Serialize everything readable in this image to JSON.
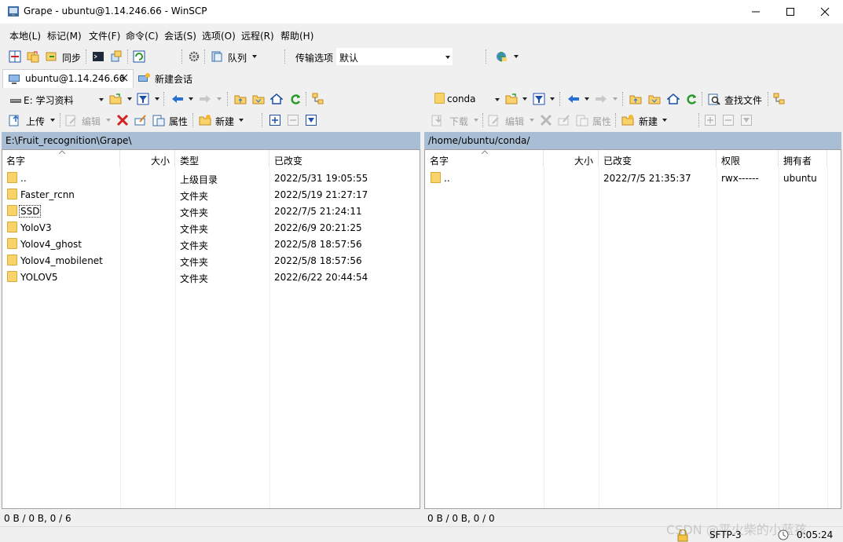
{
  "window": {
    "title": "Grape - ubuntu@1.14.246.66 - WinSCP",
    "icon": "winscp-app-icon"
  },
  "menu": [
    "本地(L)",
    "标记(M)",
    "文件(F)",
    "命令(C)",
    "会话(S)",
    "选项(O)",
    "远程(R)",
    "帮助(H)"
  ],
  "toolbar": {
    "sync_label": "同步",
    "queue_label": "队列",
    "transfer_options_label": "传输选项",
    "transfer_preset": "默认"
  },
  "tabs": [
    {
      "label": "ubuntu@1.14.246.66",
      "active": true
    },
    {
      "label": "新建会话",
      "active": false
    }
  ],
  "local": {
    "drive": "E: 学习资料",
    "upload_label": "上传",
    "edit_label": "编辑",
    "properties_label": "属性",
    "new_label": "新建",
    "path": "E:\\Fruit_recognition\\Grape\\",
    "columns": [
      "名字",
      "大小",
      "类型",
      "已改变"
    ],
    "rows": [
      {
        "name": "..",
        "size": "",
        "type": "上级目录",
        "changed": "2022/5/31  19:05:55",
        "kind": "updir"
      },
      {
        "name": "Faster_rcnn",
        "size": "",
        "type": "文件夹",
        "changed": "2022/5/19  21:27:17",
        "kind": "folder"
      },
      {
        "name": "SSD",
        "size": "",
        "type": "文件夹",
        "changed": "2022/7/5  21:24:11",
        "kind": "folder",
        "focused": true
      },
      {
        "name": "YoloV3",
        "size": "",
        "type": "文件夹",
        "changed": "2022/6/9  20:21:25",
        "kind": "folder"
      },
      {
        "name": "Yolov4_ghost",
        "size": "",
        "type": "文件夹",
        "changed": "2022/5/8  18:57:56",
        "kind": "folder"
      },
      {
        "name": "Yolov4_mobilenet",
        "size": "",
        "type": "文件夹",
        "changed": "2022/5/8  18:57:56",
        "kind": "folder"
      },
      {
        "name": "YOLOV5",
        "size": "",
        "type": "文件夹",
        "changed": "2022/6/22  20:44:54",
        "kind": "folder"
      }
    ],
    "status": "0 B / 0 B,  0 / 6"
  },
  "remote": {
    "folder": "conda",
    "find_files_label": "查找文件",
    "download_label": "下载",
    "edit_label": "编辑",
    "properties_label": "属性",
    "new_label": "新建",
    "path": "/home/ubuntu/conda/",
    "columns": [
      "名字",
      "大小",
      "已改变",
      "权限",
      "拥有者"
    ],
    "rows": [
      {
        "name": "..",
        "size": "",
        "changed": "2022/7/5 21:35:37",
        "rights": "rwx------",
        "owner": "ubuntu",
        "kind": "updir"
      }
    ],
    "status": "0 B / 0 B,  0 / 0"
  },
  "bottom": {
    "protocol": "SFTP-3",
    "elapsed": "0:05:24",
    "watermark": "CSDN @平火柴的小蓝孩"
  },
  "colors": {
    "path_bar": "#a9bed4",
    "folder": "#f9d36a",
    "delete_red": "#d42020",
    "refresh_green": "#2a9a2a",
    "nav_blue": "#2a6fd4"
  }
}
